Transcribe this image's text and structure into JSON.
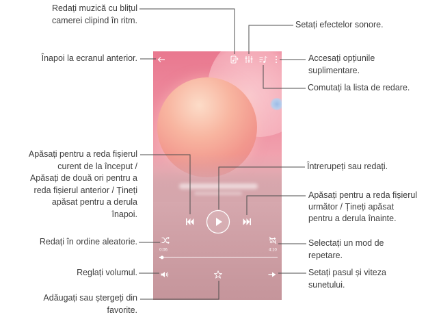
{
  "callouts": {
    "flash_sync": {
      "lines": [
        "Redați muzică cu blițul",
        "camerei clipind în ritm."
      ]
    },
    "sound_effects": {
      "lines": [
        "Setați efectelor sonore."
      ]
    },
    "back": {
      "lines": [
        "Înapoi la ecranul anterior."
      ]
    },
    "more_options": {
      "lines": [
        "Accesați opțiunile",
        "suplimentare."
      ]
    },
    "playlist": {
      "lines": [
        "Comutați la lista de redare."
      ]
    },
    "previous": {
      "lines": [
        "Apăsați pentru a reda fișierul",
        "curent de la început /",
        "Apăsați de două ori pentru a",
        "reda fișierul anterior / Țineți",
        "apăsat pentru a derula",
        "înapoi."
      ]
    },
    "play_pause": {
      "lines": [
        "Întrerupeți sau redați."
      ]
    },
    "next": {
      "lines": [
        "Apăsați pentru a reda fișierul",
        "următor / Țineți apăsat",
        "pentru a derula înainte."
      ]
    },
    "shuffle": {
      "lines": [
        "Redați în ordine aleatorie."
      ]
    },
    "repeat": {
      "lines": [
        "Selectați un mod de",
        "repetare."
      ]
    },
    "volume": {
      "lines": [
        "Reglați volumul."
      ]
    },
    "speed_pitch": {
      "lines": [
        "Setați pasul și viteza",
        "sunetului."
      ]
    },
    "favorite": {
      "lines": [
        "Adăugați sau ștergeți din",
        "favorite."
      ]
    }
  },
  "player": {
    "elapsed": "0:06",
    "duration": "4:10",
    "progress": 0.024,
    "icons": {
      "top_bar": [
        "back-arrow-icon",
        "flash-sync-icon",
        "equalizer-icon",
        "playlist-icon",
        "more-vert-icon"
      ],
      "transport": [
        "previous-icon",
        "play-icon",
        "next-icon"
      ],
      "modes": [
        "shuffle-icon",
        "repeat-icon"
      ],
      "bottom": [
        "volume-icon",
        "star-icon",
        "speed-pitch-icon"
      ]
    }
  },
  "colors": {
    "leader_line": "#4d4d4d",
    "callout_text": "#3d3d3d",
    "art_pink": "#e9788f",
    "orb_peach": "#f8b5a0",
    "lower_mauve": "#c5959b",
    "control_icons": "#ffffff"
  }
}
